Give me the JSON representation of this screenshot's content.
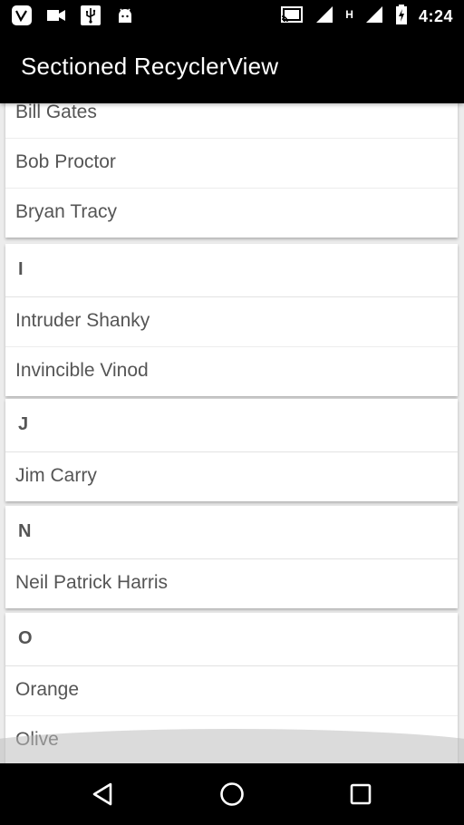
{
  "status_bar": {
    "time": "4:24",
    "network_letter": "H",
    "left_icons": [
      "vine-icon",
      "video-camera-icon",
      "usb-icon",
      "android-icon"
    ],
    "right_icons": [
      "cast-icon",
      "signal-icon",
      "signal-h-icon",
      "battery-charging-icon"
    ]
  },
  "app_bar": {
    "title": "Sectioned RecyclerView"
  },
  "list": {
    "sections": [
      {
        "header": "",
        "items": [
          "Bill Gates",
          "Bob Proctor",
          "Bryan Tracy"
        ]
      },
      {
        "header": "I",
        "items": [
          "Intruder Shanky",
          "Invincible Vinod"
        ]
      },
      {
        "header": "J",
        "items": [
          "Jim Carry"
        ]
      },
      {
        "header": "N",
        "items": [
          "Neil Patrick Harris"
        ]
      },
      {
        "header": "O",
        "items": [
          "Orange",
          "Olive"
        ]
      }
    ]
  },
  "nav_bar": {
    "buttons": [
      "back-icon",
      "home-icon",
      "recents-icon"
    ]
  }
}
